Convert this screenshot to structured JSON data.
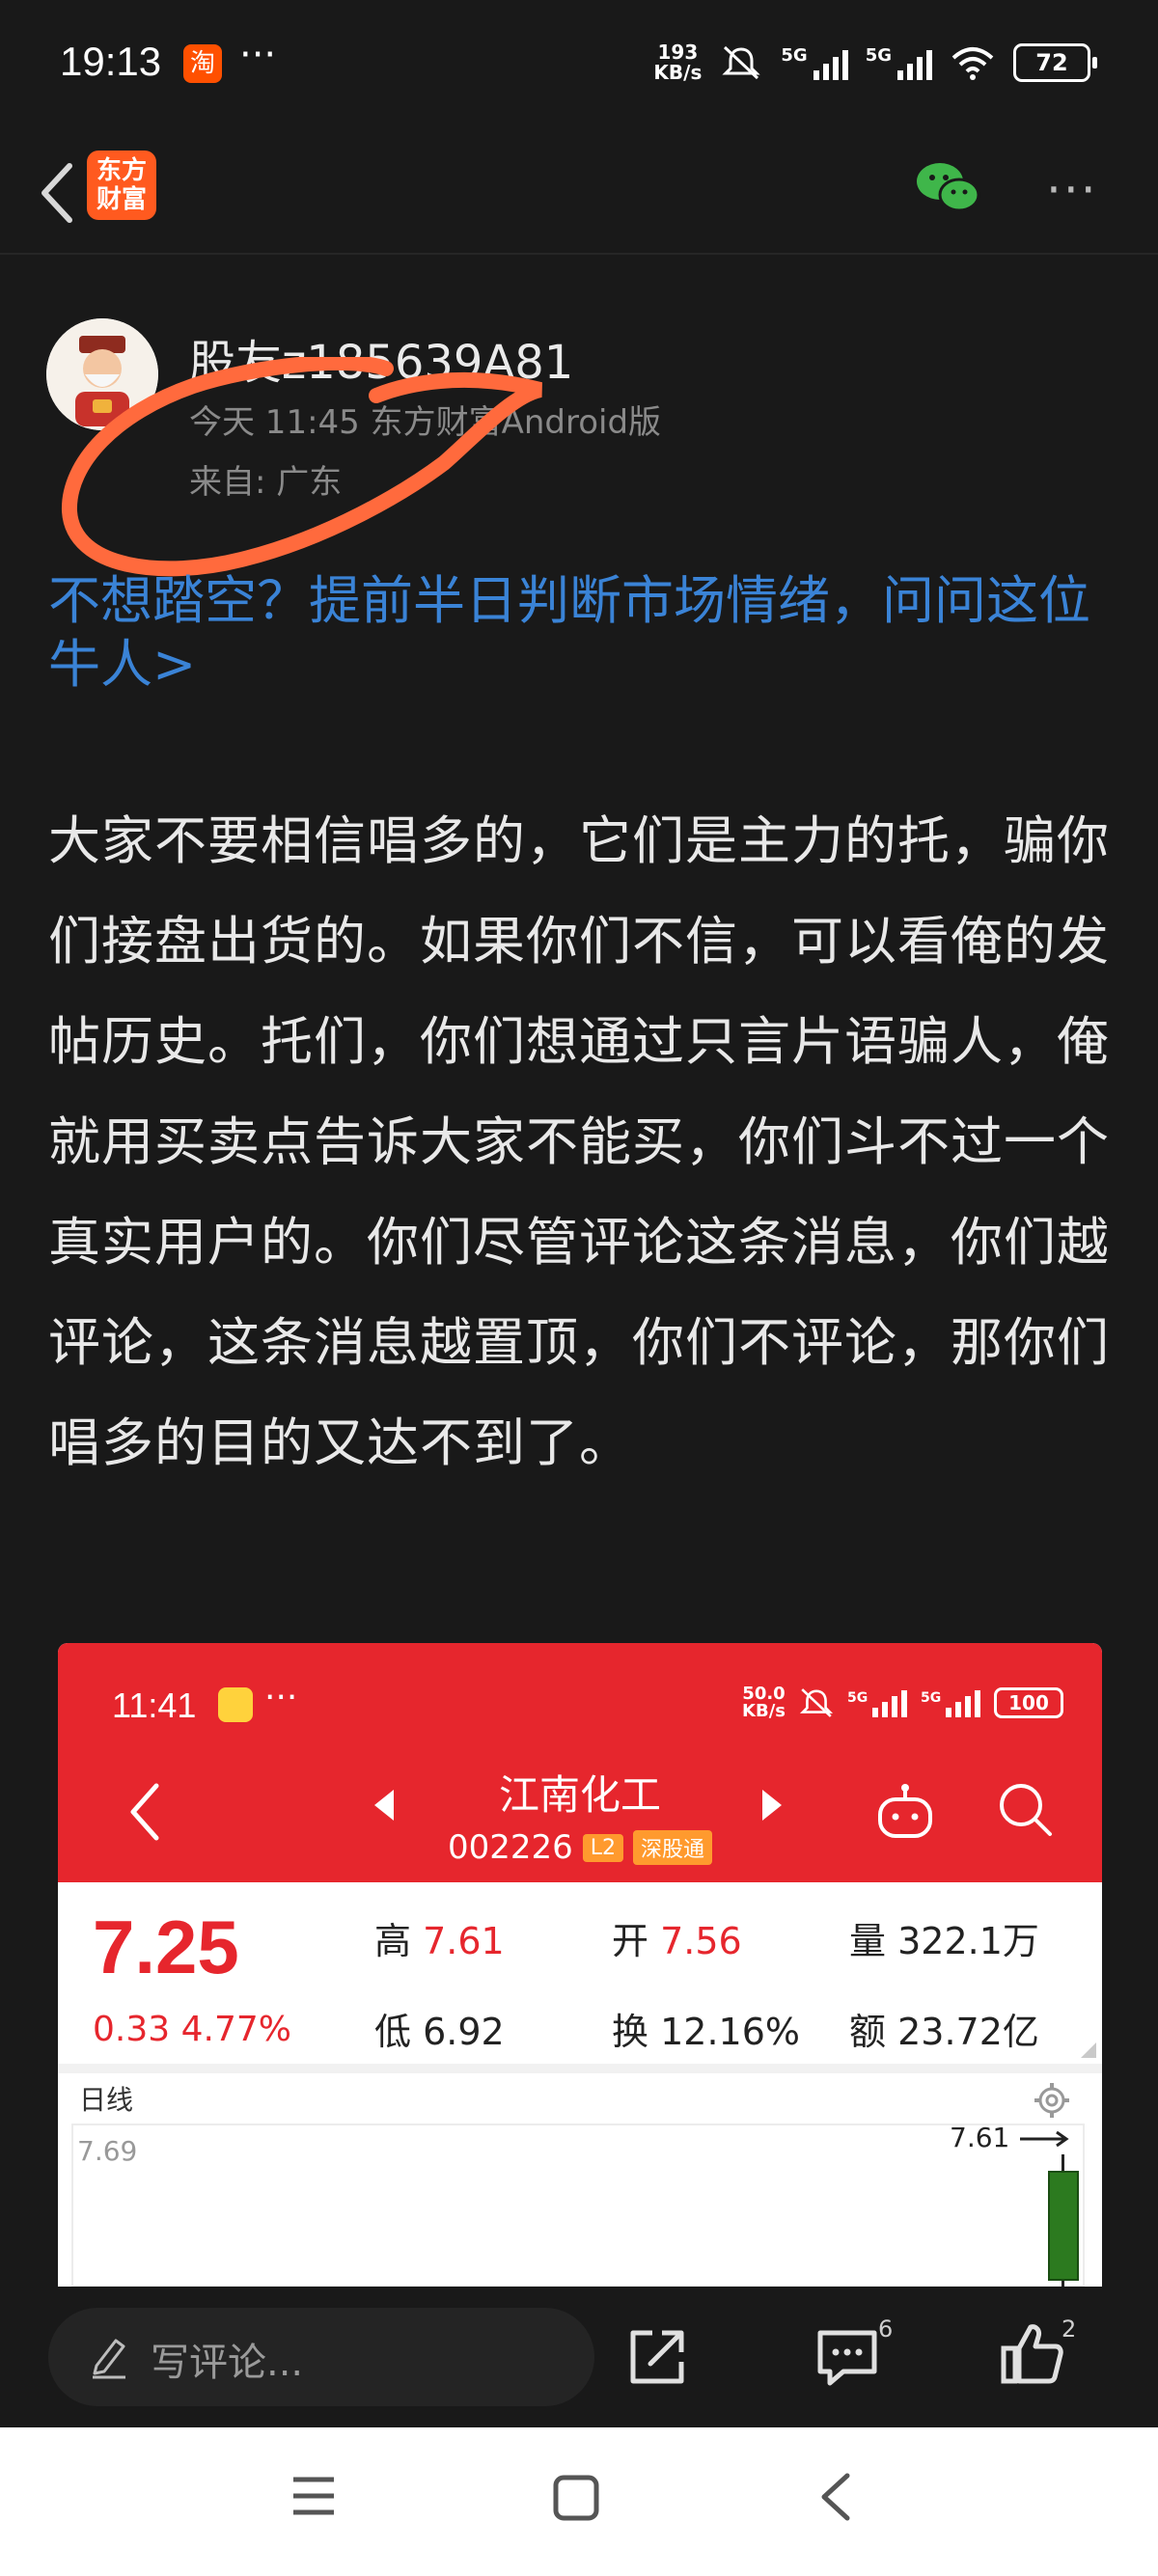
{
  "status_bar": {
    "time": "19:13",
    "taobao_glyph": "淘",
    "more": "···",
    "net_speed_value": "193",
    "net_speed_unit": "KB/s",
    "net_type_1": "5G",
    "net_type_2": "5G",
    "battery": "72",
    "icons": [
      "taobao-icon",
      "mute-icon",
      "signal-icon",
      "signal-icon",
      "wifi-icon",
      "battery-icon"
    ]
  },
  "top_nav": {
    "logo_text": "东方财富",
    "icons": [
      "back-icon",
      "wechat-share-icon",
      "more-icon"
    ],
    "more": "···"
  },
  "post": {
    "username": "股友z185639A81",
    "meta": "今天 11:45 东方财富Android版",
    "location": "来自: 广东",
    "promo_link": "不想踏空？提前半日判断市场情绪，问问这位牛人>",
    "body": "大家不要相信唱多的，它们是主力的托，骗你们接盘出货的。如果你们不信，可以看俺的发帖历史。托们，你们想通过只言片语骗人，俺就用买卖点告诉大家不能买，你们斗不过一个真实用户的。你们尽管评论这条消息，你们越评论，这条消息越置顶，你们不评论，那你们唱多的目的又达不到了。"
  },
  "embedded_screenshot": {
    "status_time": "11:41",
    "status_more": "···",
    "status_speed_value": "50.0",
    "status_speed_unit": "KB/s",
    "status_battery": "100",
    "stock_name": "江南化工",
    "stock_code": "002226",
    "badge_l2": "L2",
    "badge_sgt": "深股通",
    "price": "7.25",
    "change": "0.33  4.77%",
    "stats": {
      "high_label": "高",
      "high_value": "7.61",
      "open_label": "开",
      "open_value": "7.56",
      "vol_label": "量",
      "vol_value": "322.1万",
      "low_label": "低",
      "low_value": "6.92",
      "turnover_label": "换",
      "turnover_value": "12.16%",
      "amount_label": "额",
      "amount_value": "23.72亿"
    },
    "chart_tab": "日线",
    "chart_high_label": "7.69",
    "chart_marker": "7.61",
    "colors": {
      "header": "#e6262d",
      "up": "#e6262d",
      "candle_down": "#2c7a1f"
    }
  },
  "bottom_bar": {
    "comment_placeholder": "写评论...",
    "comment_count": "6",
    "like_count": "2",
    "icons": [
      "edit-icon",
      "share-icon",
      "comment-icon",
      "like-icon"
    ]
  },
  "system_nav": {
    "icons": [
      "menu-icon",
      "home-icon",
      "back-icon"
    ]
  },
  "colors": {
    "background": "#191919",
    "link": "#3a83d6",
    "annotation_scribble": "#ff6a3d"
  }
}
